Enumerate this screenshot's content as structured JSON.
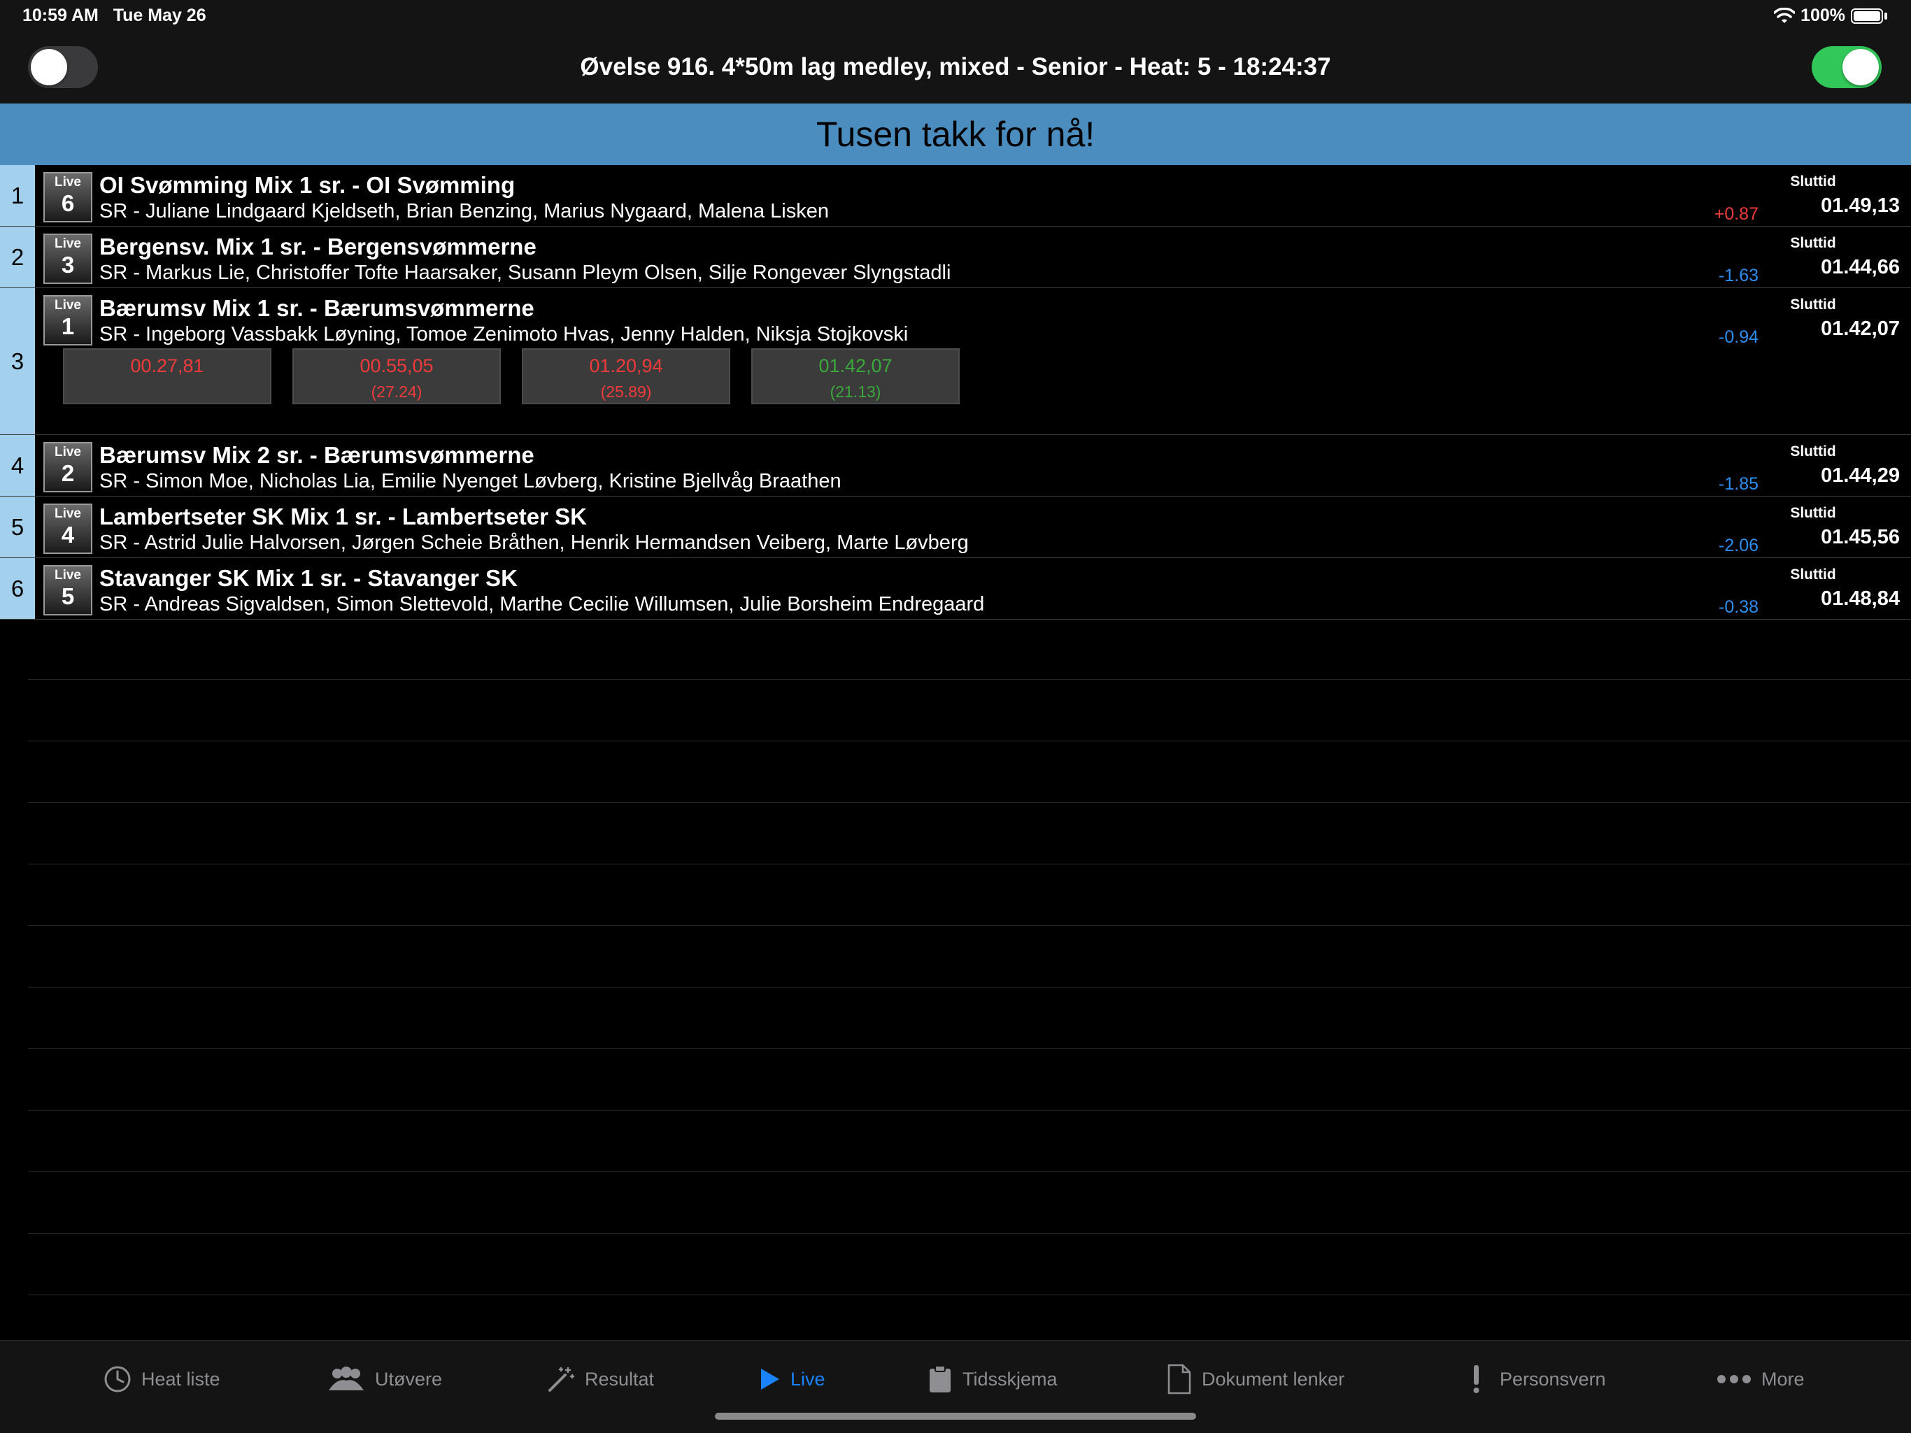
{
  "status": {
    "time": "10:59 AM",
    "date": "Tue May 26",
    "battery": "100%"
  },
  "nav": {
    "title": "Øvelse 916. 4*50m lag medley, mixed - Senior - Heat: 5 - 18:24:37"
  },
  "banner": {
    "text": "Tusen takk for nå!"
  },
  "rows": [
    {
      "place": "1",
      "live": "Live",
      "lane": "6",
      "team": "OI Svømming Mix 1 sr.  - OI Svømming",
      "swimmers": "SR - Juliane Lindgaard Kjeldseth, Brian Benzing, Marius Nygaard, Malena Lisken",
      "diff": "+0.87",
      "final_label": "Sluttid",
      "final_time": "01.49,13"
    },
    {
      "place": "2",
      "live": "Live",
      "lane": "3",
      "team": "Bergensv. Mix 1 sr.  - Bergensvømmerne",
      "swimmers": "SR - Markus Lie, Christoffer Tofte Haarsaker, Susann Pleym Olsen, Silje Rongevær Slyngstadli",
      "diff": "-1.63",
      "final_label": "Sluttid",
      "final_time": "01.44,66"
    },
    {
      "place": "3",
      "live": "Live",
      "lane": "1",
      "team": "Bærumsv Mix 1 sr.  - Bærumsvømmerne",
      "swimmers": "SR - Ingeborg Vassbakk Løyning, Tomoe Zenimoto Hvas, Jenny Halden, Niksja Stojkovski",
      "diff": "-0.94",
      "final_label": "Sluttid",
      "final_time": "01.42,07",
      "splits": [
        {
          "time": "00.27,81",
          "lap": ""
        },
        {
          "time": "00.55,05",
          "lap": "(27.24)"
        },
        {
          "time": "01.20,94",
          "lap": "(25.89)"
        },
        {
          "time": "01.42,07",
          "lap": "(21.13)"
        }
      ]
    },
    {
      "place": "4",
      "live": "Live",
      "lane": "2",
      "team": "Bærumsv Mix 2 sr.  - Bærumsvømmerne",
      "swimmers": "SR - Simon Moe, Nicholas Lia, Emilie Nyenget Løvberg, Kristine Bjellvåg Braathen",
      "diff": "-1.85",
      "final_label": "Sluttid",
      "final_time": "01.44,29"
    },
    {
      "place": "5",
      "live": "Live",
      "lane": "4",
      "team": "Lambertseter SK Mix 1 sr.  - Lambertseter SK",
      "swimmers": "SR - Astrid Julie Halvorsen, Jørgen Scheie Bråthen, Henrik Hermandsen Veiberg, Marte Løvberg",
      "diff": "-2.06",
      "final_label": "Sluttid",
      "final_time": "01.45,56"
    },
    {
      "place": "6",
      "live": "Live",
      "lane": "5",
      "team": "Stavanger SK Mix 1 sr.  - Stavanger SK",
      "swimmers": "SR - Andreas Sigvaldsen, Simon Slettevold, Marthe Cecilie Willumsen, Julie Borsheim Endregaard",
      "diff": "-0.38",
      "final_label": "Sluttid",
      "final_time": "01.48,84"
    }
  ],
  "tabs": [
    {
      "label": "Heat liste",
      "icon": "clock-icon"
    },
    {
      "label": "Utøvere",
      "icon": "people-icon"
    },
    {
      "label": "Resultat",
      "icon": "magic-wand-icon"
    },
    {
      "label": "Live",
      "icon": "play-icon"
    },
    {
      "label": "Tidsskjema",
      "icon": "clipboard-icon"
    },
    {
      "label": "Dokument lenker",
      "icon": "document-icon"
    },
    {
      "label": "Personsvern",
      "icon": "exclamation-icon"
    },
    {
      "label": "More",
      "icon": "more-icon"
    }
  ],
  "colors": {
    "banner": "#4a8dbe",
    "row_number": "#a3d0ec",
    "diff_positive": "#ef3b3b",
    "diff_negative": "#2d8ef0",
    "split_fast": "#3aa83a",
    "split": "#ef3b3b",
    "tab_active": "#1a82fb",
    "toggle_on": "#32c759"
  }
}
